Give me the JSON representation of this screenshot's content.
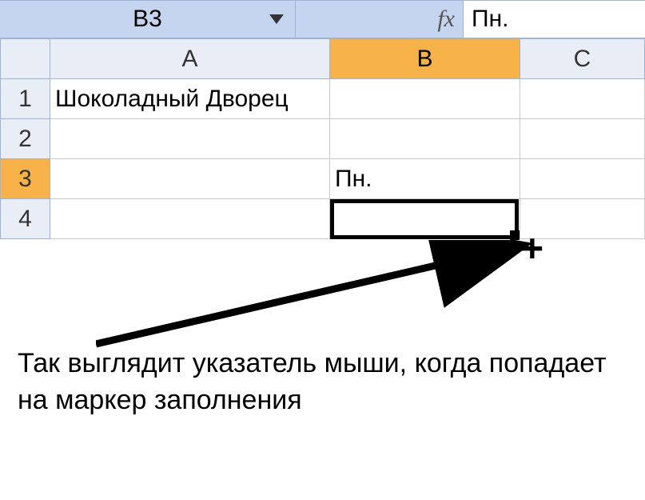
{
  "nameBox": {
    "cellRef": "B3"
  },
  "formulaBar": {
    "fxLabel": "fx",
    "value": "Пн."
  },
  "columns": {
    "A": "A",
    "B": "B",
    "C": "C"
  },
  "rows": {
    "r1": "1",
    "r2": "2",
    "r3": "3",
    "r4": "4"
  },
  "cells": {
    "A1": "Шоколадный Дворец",
    "B3": "Пн."
  },
  "selection": {
    "activeCell": "B3"
  },
  "annotation": "Так выглядит указатель мыши, когда попадает на маркер заполнения",
  "cursor": {
    "glyph": "+"
  }
}
